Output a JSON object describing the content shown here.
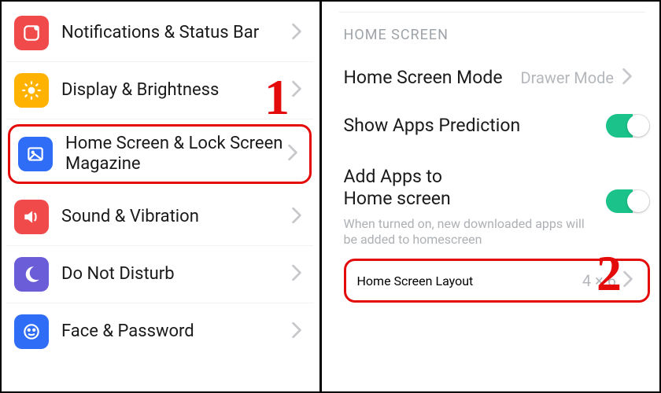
{
  "left": {
    "items": [
      {
        "label": "Notifications & Status Bar",
        "icon": "notification-icon",
        "bg": "#f14a4a"
      },
      {
        "label": "Display & Brightness",
        "icon": "brightness-icon",
        "bg": "#ffb300"
      },
      {
        "label": "Home Screen & Lock Screen Magazine",
        "icon": "picture-icon",
        "bg": "#2f6df6",
        "highlighted": true
      },
      {
        "label": "Sound & Vibration",
        "icon": "sound-icon",
        "bg": "#f14a4a"
      },
      {
        "label": "Do Not Disturb",
        "icon": "moon-icon",
        "bg": "#6b5cd8"
      },
      {
        "label": "Face & Password",
        "icon": "face-icon",
        "bg": "#2f6df6"
      }
    ]
  },
  "right": {
    "section_caption": "HOME SCREEN",
    "mode": {
      "label": "Home Screen Mode",
      "value": "Drawer Mode"
    },
    "prediction": {
      "label": "Show Apps Prediction",
      "on": true
    },
    "add_apps": {
      "label": "Add Apps to Home screen",
      "sub": "When turned on, new downloaded apps will be added to homescreen",
      "on": true
    },
    "layout": {
      "label": "Home Screen Layout",
      "value": "4 × 6",
      "highlighted": true
    }
  },
  "annotations": {
    "step1": "1",
    "step2": "2"
  }
}
